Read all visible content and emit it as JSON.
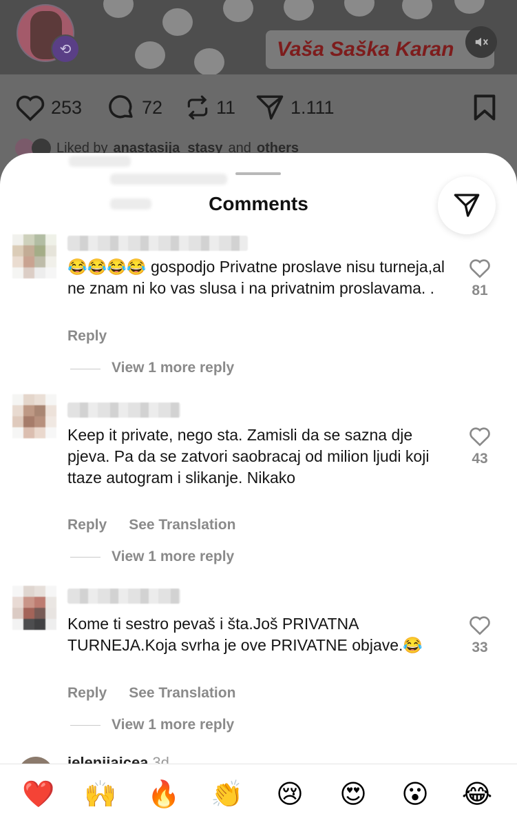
{
  "post": {
    "video_title": "Vaša Saška Karan",
    "likes": "253",
    "comments": "72",
    "reposts": "11",
    "shares": "1.111",
    "liked_by_prefix": "Liked by",
    "liked_by_user": "anastasija_stasy",
    "liked_by_and": "and",
    "liked_by_others": "others"
  },
  "sheet": {
    "title": "Comments"
  },
  "comments": [
    {
      "text": "😂😂😂😂 gospodjo Privatne proslave nisu turneja,al ne znam ni ko vas slusa i na privatnim proslavama. .",
      "reply_label": "Reply",
      "likes": "81",
      "view_more": "View 1 more reply"
    },
    {
      "text": "Keep it private, nego sta. Zamisli da se sazna dje pjeva. Pa da se zatvori saobracaj od milion ljudi koji ttaze autogram i slikanje. Nikako",
      "reply_label": "Reply",
      "translate_label": "See Translation",
      "likes": "43",
      "view_more": "View 1 more reply"
    },
    {
      "text": "Kome ti sestro pevaš i šta.Još PRIVATNA TURNEJA.Koja svrha je ove PRIVATNE objave.😂",
      "reply_label": "Reply",
      "translate_label": "See Translation",
      "likes": "33",
      "view_more": "View 1 more reply"
    }
  ],
  "next_comment": {
    "username": "jelenijajcea",
    "time": "3d"
  },
  "reactions": [
    "❤️",
    "🙌",
    "🔥",
    "👏",
    "😢",
    "😍",
    "😮",
    "😂"
  ]
}
